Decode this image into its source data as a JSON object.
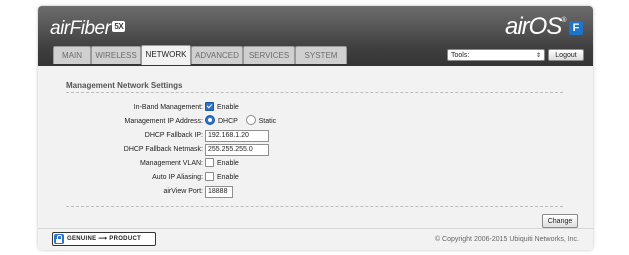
{
  "header": {
    "product_logo": "airFiber",
    "product_badge": "5X",
    "os_logo": "airOS",
    "os_badge": "F"
  },
  "tabs": [
    {
      "label": "MAIN",
      "active": false
    },
    {
      "label": "WIRELESS",
      "active": false
    },
    {
      "label": "NETWORK",
      "active": true
    },
    {
      "label": "ADVANCED",
      "active": false
    },
    {
      "label": "SERVICES",
      "active": false
    },
    {
      "label": "SYSTEM",
      "active": false
    }
  ],
  "tools": {
    "selected": "Tools:",
    "arrow_icon": "up-down-arrow-icon"
  },
  "logout_label": "Logout",
  "section": {
    "title": "Management Network Settings"
  },
  "fields": {
    "inband": {
      "label": "In-Band Management:",
      "checked": true,
      "option": "Enable"
    },
    "mgmt_ip": {
      "label": "Management IP Address:",
      "options": [
        "DHCP",
        "Static"
      ],
      "selected": "DHCP"
    },
    "fallback_ip": {
      "label": "DHCP Fallback IP:",
      "value": "192.168.1.20"
    },
    "fallback_netmask": {
      "label": "DHCP Fallback Netmask:",
      "value": "255.255.255.0"
    },
    "mgmt_vlan": {
      "label": "Management VLAN:",
      "checked": false,
      "option": "Enable"
    },
    "auto_ip": {
      "label": "Auto IP Aliasing:",
      "checked": false,
      "option": "Enable"
    },
    "airview_port": {
      "label": "airView Port:",
      "value": "18888"
    }
  },
  "change_label": "Change",
  "footer": {
    "genuine_text": "GENUINE",
    "product_text": "PRODUCT",
    "copyright": "© Copyright 2006-2015 Ubiquiti Networks, Inc."
  },
  "colors": {
    "accent": "#2b73c9",
    "header_dark": "#3f3f3f"
  }
}
